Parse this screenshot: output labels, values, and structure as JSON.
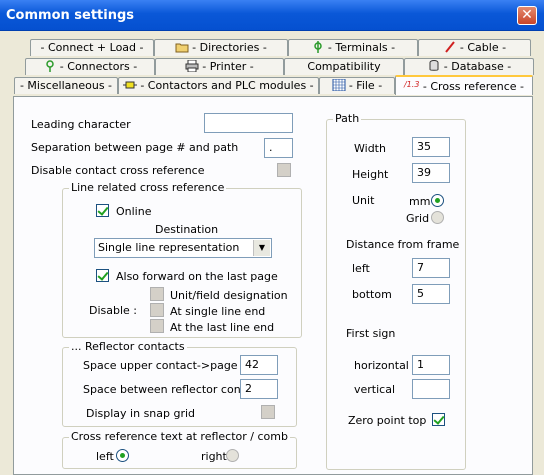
{
  "window": {
    "title": "Common settings"
  },
  "tabs": {
    "row1": [
      "- Connect + Load -",
      "- Directories -",
      "- Terminals -",
      "- Cable -"
    ],
    "row2": [
      "- Connectors -",
      "- Printer -",
      "Compatibility",
      "- Database -"
    ],
    "row3": [
      "- Miscellaneous -",
      "- Contactors and PLC modules -",
      "- File -",
      "- Cross reference -"
    ],
    "cross_ref_icon_text": "/1.3"
  },
  "general": {
    "leading_character_label": "Leading character",
    "leading_character_value": "",
    "separation_label": "Separation between page # and path",
    "separation_value": ".",
    "disable_contact_label": "Disable contact cross reference"
  },
  "line_related": {
    "title": "Line related cross reference",
    "online_label": "Online",
    "destination_label": "Destination",
    "destination_selected": "Single line representation",
    "also_forward_label": "Also forward on the last page",
    "disable_label": "Disable :",
    "unit_field_label": "Unit/field designation",
    "single_line_end_label": "At single line end",
    "last_line_end_label": "At the last line end"
  },
  "reflector": {
    "title": "... Reflector contacts",
    "space_upper_label": "Space upper contact->page",
    "space_upper_value": "42",
    "space_between_label": "Space between reflector cont.",
    "space_between_value": "2",
    "snap_grid_label": "Display in snap grid"
  },
  "cross_text": {
    "title": "Cross reference text at reflector / comb",
    "left_label": "left",
    "right_label": "right"
  },
  "path": {
    "title": "Path",
    "width_label": "Width",
    "width_value": "35",
    "height_label": "Height",
    "height_value": "39",
    "unit_label": "Unit",
    "mm_label": "mm",
    "grid_label": "Grid",
    "distance_label": "Distance from frame",
    "left_label": "left",
    "left_value": "7",
    "bottom_label": "bottom",
    "bottom_value": "5",
    "first_sign_label": "First sign",
    "horizontal_label": "horizontal",
    "horizontal_value": "1",
    "vertical_label": "vertical",
    "vertical_value": "",
    "zero_point_label": "Zero point top"
  }
}
